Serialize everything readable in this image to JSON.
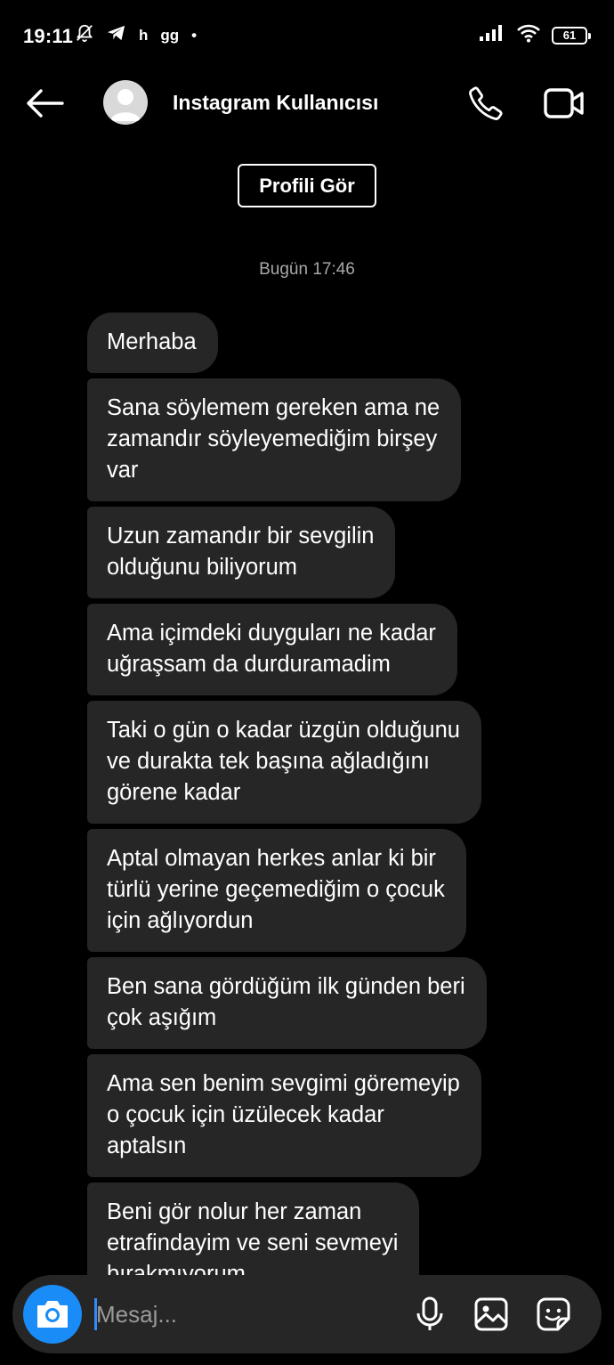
{
  "status_bar": {
    "time": "19:11",
    "left_text_1": "h",
    "left_text_2": "gg",
    "left_dot": "•",
    "battery": "61"
  },
  "header": {
    "contact_name": "Instagram Kullanıcısı",
    "icons": [
      "arrow-left-icon",
      "phone-icon",
      "video-camera-icon"
    ]
  },
  "profile_button_label": "Profili Gör",
  "timestamp": "Bugün 17:46",
  "messages": [
    "Merhaba",
    "Sana söylemem gereken ama ne\nzamandır söyleyemediğim birşey\nvar",
    "Uzun zamandır bir sevgilin\nolduğunu biliyorum",
    "Ama içimdeki duyguları ne kadar\nuğraşsam da durduramadim",
    "Taki o gün o kadar üzgün olduğunu\nve durakta tek başına ağladığını\ngörene kadar",
    "Aptal olmayan herkes anlar ki bir\ntürlü yerine geçemediğim o çocuk\niçin ağlıyordun",
    "Ben sana gördüğüm ilk günden beri\nçok aşığım",
    "Ama sen benim sevgimi göremeyip\no çocuk için üzülecek kadar\naptalsın",
    "Beni gör nolur her zaman\netrafindayim ve seni sevmeyi\nbırakmıyorum"
  ],
  "composer": {
    "placeholder": "Mesaj...",
    "value": "",
    "accent_color": "#1a8cf8"
  }
}
